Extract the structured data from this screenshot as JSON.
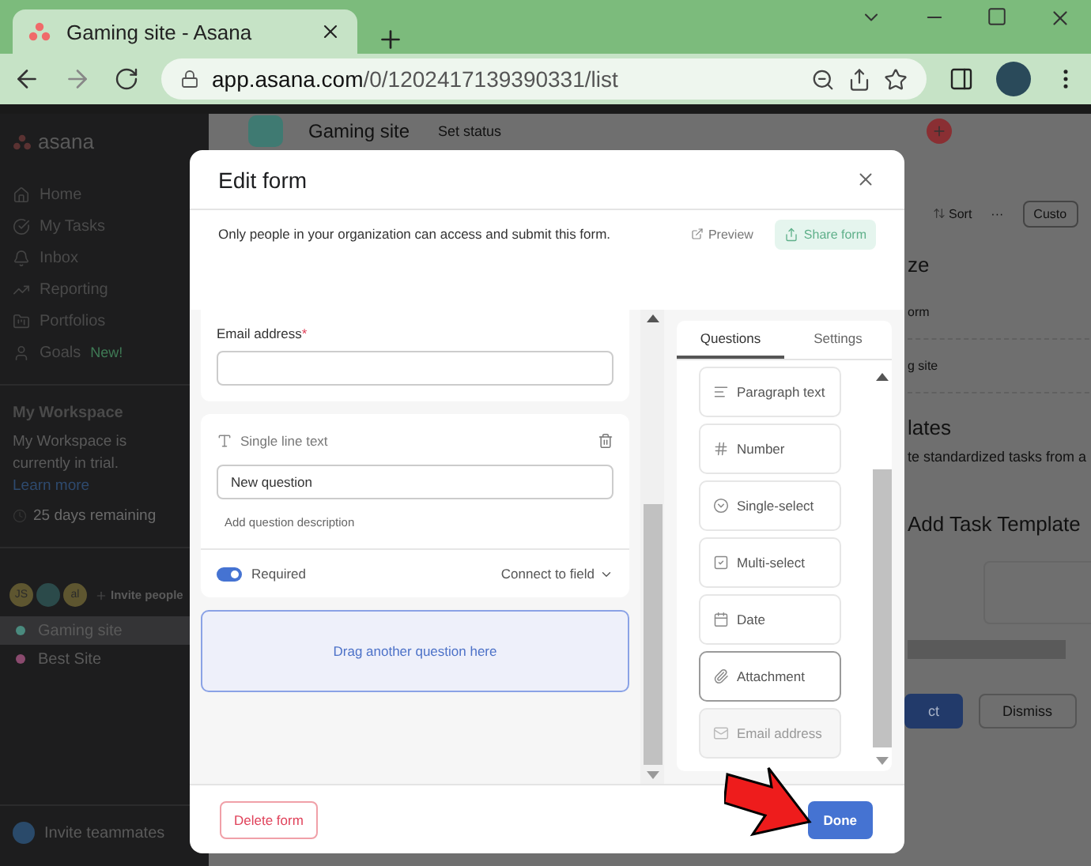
{
  "browser": {
    "tab_title": "Gaming site - Asana",
    "url_host": "app.asana.com",
    "url_path": "/0/1202417139390331/list"
  },
  "sidebar": {
    "logo": "asana",
    "nav": [
      {
        "label": "Home",
        "kind": "home"
      },
      {
        "label": "My Tasks",
        "kind": "tasks"
      },
      {
        "label": "Inbox",
        "kind": "inbox"
      },
      {
        "label": "Reporting",
        "kind": "reporting"
      },
      {
        "label": "Portfolios",
        "kind": "portfolios"
      },
      {
        "label": "Goals",
        "kind": "goals",
        "badge": "New!"
      }
    ],
    "workspace_title": "My Workspace",
    "trial_text": "My Workspace is currently in trial.",
    "trial_link": "Learn more",
    "days_left": "25 days remaining",
    "avatars": [
      {
        "kind": "initials",
        "text": "JS"
      },
      {
        "kind": "image"
      },
      {
        "kind": "initials",
        "text": "al"
      }
    ],
    "invite_people": "Invite people",
    "projects": [
      {
        "name": "Gaming site",
        "color": "#4a8a7e",
        "selected": true
      },
      {
        "name": "Best Site",
        "color": "#8a4a6e",
        "selected": false
      }
    ],
    "invite_teammates": "Invite teammates"
  },
  "header": {
    "project": "Gaming site",
    "status": "Set status"
  },
  "toolbar": {
    "sort": "Sort",
    "more": "···",
    "customize": "Custo"
  },
  "background_texts": [
    {
      "kind": "heading",
      "text": "ze"
    },
    {
      "kind": "row",
      "text": "orm"
    },
    {
      "kind": "row",
      "text": "g site"
    },
    {
      "kind": "heading",
      "text": "lates"
    },
    {
      "kind": "body",
      "text": "te standardized tasks from a"
    },
    {
      "kind": "heading",
      "text": "Add Task Template"
    }
  ],
  "banner_buttons": [
    "ct",
    "Dismiss"
  ],
  "modal": {
    "title": "Edit form",
    "notice": "Only people in your organization can access and submit this form.",
    "preview": "Preview",
    "share": "Share form",
    "email_question": {
      "label": "Email address",
      "required": true,
      "required_mark": "*"
    },
    "question": {
      "type_label": "Single line text",
      "value": "New question",
      "description": "Add question description",
      "required": true,
      "required_label": "Required",
      "connect": "Connect to field"
    },
    "drop_zone": "Drag another question here",
    "tabs": [
      {
        "label": "Questions",
        "selected": true
      },
      {
        "label": "Settings",
        "selected": false
      }
    ],
    "question_types": [
      {
        "label": "Paragraph text",
        "kind": "paragraph",
        "highlighted": false,
        "disabled": false
      },
      {
        "label": "Number",
        "kind": "number",
        "highlighted": false,
        "disabled": false
      },
      {
        "label": "Single-select",
        "kind": "single",
        "highlighted": false,
        "disabled": false
      },
      {
        "label": "Multi-select",
        "kind": "multi",
        "highlighted": false,
        "disabled": false
      },
      {
        "label": "Date",
        "kind": "date",
        "highlighted": false,
        "disabled": false
      },
      {
        "label": "Attachment",
        "kind": "attachment",
        "highlighted": true,
        "disabled": false
      },
      {
        "label": "Email address",
        "kind": "email",
        "highlighted": false,
        "disabled": true
      }
    ],
    "delete": "Delete form",
    "done": "Done"
  }
}
